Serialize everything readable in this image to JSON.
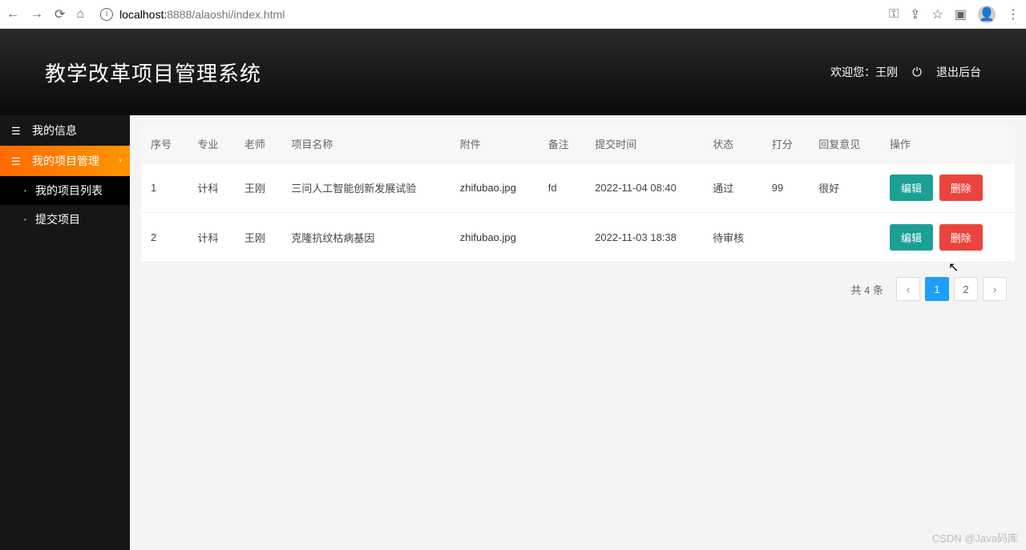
{
  "browser": {
    "url_host": "localhost:",
    "url_port": "8888",
    "url_path": "/alaoshi/index.html"
  },
  "header": {
    "title": "教学改革项目管理系统",
    "welcome": "欢迎您：王刚",
    "logout": "退出后台"
  },
  "sidebar": {
    "items": [
      {
        "label": "我的信息",
        "active": false
      },
      {
        "label": "我的项目管理",
        "active": true
      }
    ],
    "submenu": [
      {
        "label": "我的项目列表",
        "selected": true
      },
      {
        "label": "提交项目",
        "selected": false
      }
    ]
  },
  "table": {
    "headers": [
      "序号",
      "专业",
      "老师",
      "项目名称",
      "附件",
      "备注",
      "提交时间",
      "状态",
      "打分",
      "回复意见",
      "操作"
    ],
    "rows": [
      {
        "seq": "1",
        "major": "计科",
        "teacher": "王刚",
        "project": "三问人工智能创新发展试验",
        "file": "zhifubao.jpg",
        "remark": "fd",
        "time": "2022-11-04 08:40",
        "status": "通过",
        "score": "99",
        "reply": "很好"
      },
      {
        "seq": "2",
        "major": "计科",
        "teacher": "王刚",
        "project": "克隆抗纹枯病基因",
        "file": "zhifubao.jpg",
        "remark": "",
        "time": "2022-11-03 18:38",
        "status": "待审核",
        "score": "",
        "reply": ""
      }
    ],
    "actions": {
      "edit": "编辑",
      "delete": "删除"
    }
  },
  "pagination": {
    "total_text": "共 4 条",
    "pages": [
      "1",
      "2"
    ],
    "current": "1"
  },
  "watermark": "CSDN @Java码库"
}
